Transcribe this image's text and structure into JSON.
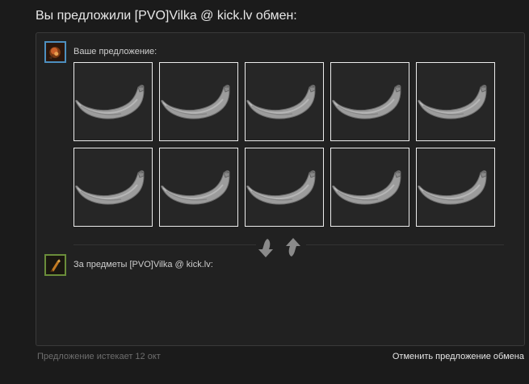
{
  "header": {
    "title": "Вы предложили [PVO]Vilka @ kick.lv обмен:"
  },
  "your_offer": {
    "label": "Ваше предложение:",
    "avatar_icon": "user-avatar-icon",
    "items": [
      {
        "icon": "banana-icon"
      },
      {
        "icon": "banana-icon"
      },
      {
        "icon": "banana-icon"
      },
      {
        "icon": "banana-icon"
      },
      {
        "icon": "banana-icon"
      },
      {
        "icon": "banana-icon"
      },
      {
        "icon": "banana-icon"
      },
      {
        "icon": "banana-icon"
      },
      {
        "icon": "banana-icon"
      },
      {
        "icon": "banana-icon"
      }
    ]
  },
  "swap": {
    "icon": "swap-arrows-icon"
  },
  "their_offer": {
    "label": "За предметы [PVO]Vilka @ kick.lv:",
    "avatar_icon": "partner-avatar-icon",
    "items": []
  },
  "footer": {
    "expires": "Предложение истекает 12 окт",
    "cancel_label": "Отменить предложение обмена"
  },
  "colors": {
    "background": "#1b1b1b",
    "panel": "#212121",
    "item_border": "#ececec",
    "avatar_border_blue": "#4d8fbf",
    "avatar_border_green": "#6a8d3a"
  }
}
